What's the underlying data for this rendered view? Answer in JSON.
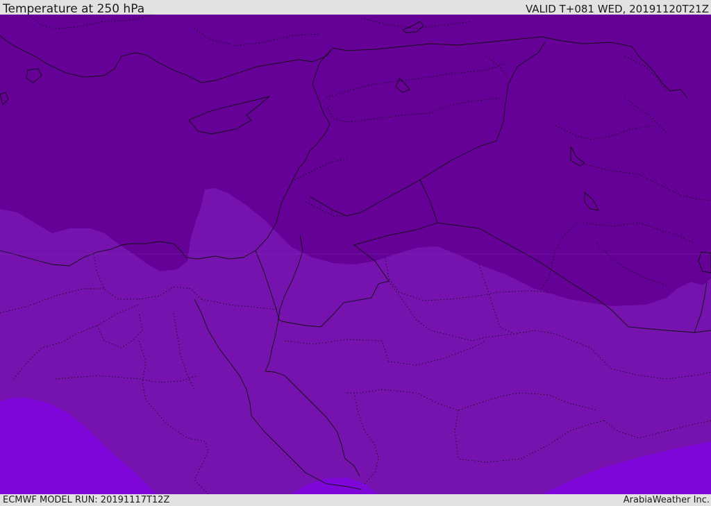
{
  "header": {
    "title": "Temperature at 250 hPa",
    "valid_time": "VALID T+081 WED, 20191120T21Z"
  },
  "footer": {
    "model_run": "ECMWF MODEL RUN: 20191117T12Z",
    "brand": "ArabiaWeather Inc."
  },
  "map": {
    "variable": "temperature",
    "pressure_level_hpa": 250,
    "fill_colors": {
      "coldest_band": "#650197",
      "middle_band": "#7612ae",
      "warmest_band": "#7e06d8"
    },
    "coastline_color": "#111111",
    "border_color": "#111111",
    "internal_border_style": "dotted"
  }
}
